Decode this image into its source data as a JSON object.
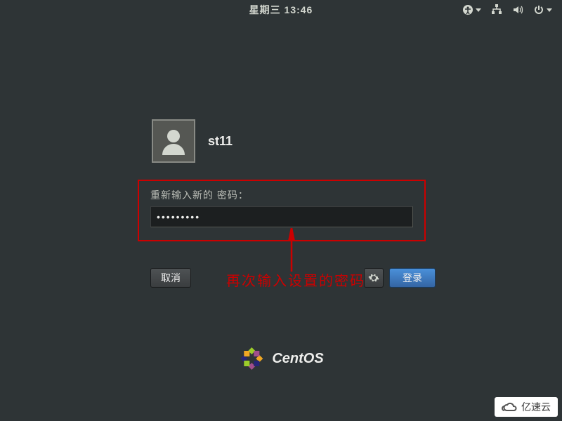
{
  "topbar": {
    "datetime": "星期三 13:46"
  },
  "login": {
    "username": "st11",
    "password_label": "重新输入新的 密码：",
    "password_value": "●●●●●●●●●",
    "cancel_label": "取消",
    "login_label": "登录"
  },
  "annotation": {
    "text": "再次输入设置的密码"
  },
  "branding": {
    "os_name": "CentOS"
  },
  "watermark": {
    "text": "亿速云"
  }
}
